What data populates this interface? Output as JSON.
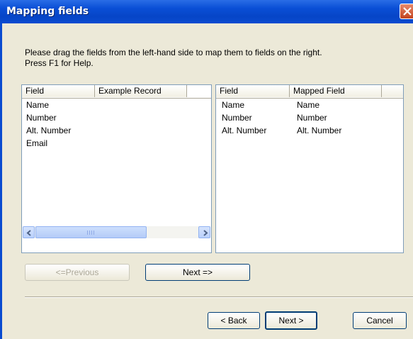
{
  "window": {
    "title": "Mapping fields"
  },
  "instructions": {
    "line1": "Please drag the fields from the left-hand side to map them to fields on the right.",
    "line2": "Press F1 for Help."
  },
  "left_list": {
    "columns": [
      "Field",
      "Example Record"
    ],
    "rows": [
      "Name",
      "Number",
      "Alt. Number",
      "Email"
    ],
    "scroll_grip": "|||"
  },
  "right_list": {
    "columns": [
      "Field",
      "Mapped Field"
    ],
    "rows": [
      {
        "field": "Name",
        "mapped": "Name"
      },
      {
        "field": "Number",
        "mapped": "Number"
      },
      {
        "field": "Alt. Number",
        "mapped": "Alt. Number"
      }
    ]
  },
  "nav": {
    "previous_label": "<=Previous",
    "next_label": "Next =>"
  },
  "footer": {
    "back_label": "< Back",
    "next_label": "Next >",
    "cancel_label": "Cancel"
  },
  "icons": {
    "close": "close-icon",
    "scroll_left": "arrow-left-icon",
    "scroll_right": "arrow-right-icon"
  }
}
